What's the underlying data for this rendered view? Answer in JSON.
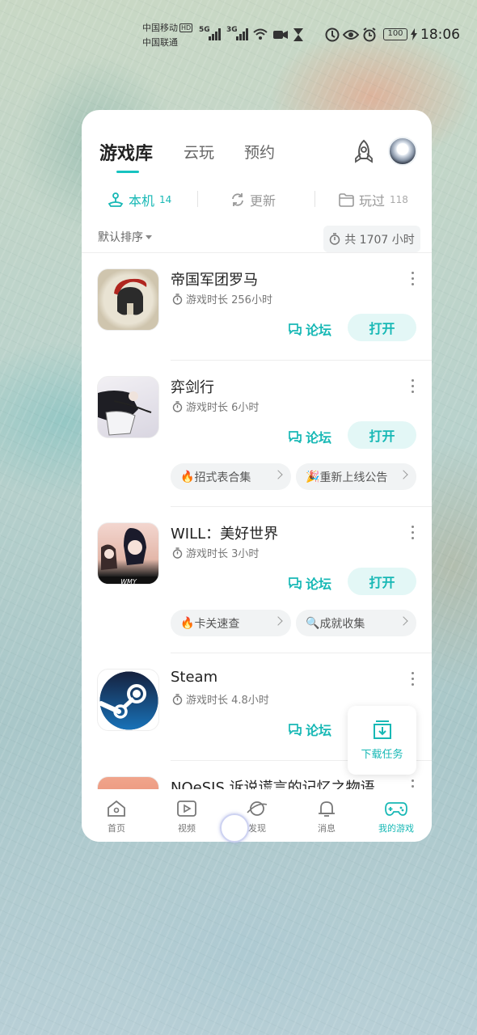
{
  "status_bar": {
    "carrier1": "中国移动",
    "carrier1_badge": "HD",
    "carrier2": "中国联通",
    "net1": "5G",
    "net2": "3G",
    "battery": "100",
    "time": "18:06"
  },
  "header": {
    "tabs": [
      {
        "label": "游戏库",
        "active": true
      },
      {
        "label": "云玩",
        "active": false
      },
      {
        "label": "预约",
        "active": false
      }
    ],
    "icons": [
      "rocket-icon",
      "avatar"
    ]
  },
  "subtabs": [
    {
      "label": "本机",
      "count": "14",
      "active": true
    },
    {
      "label": "更新",
      "count": "",
      "active": false
    },
    {
      "label": "玩过",
      "count": "118",
      "active": false
    }
  ],
  "sort": {
    "label": "默认排序",
    "total": "共 1707 小时"
  },
  "games": [
    {
      "name": "帝国军团罗马",
      "time": "游戏时长 256小时",
      "forum": "论坛",
      "open": "打开",
      "chips": []
    },
    {
      "name": "弈剑行",
      "time": "游戏时长 6小时",
      "forum": "论坛",
      "open": "打开",
      "chips": [
        {
          "emoji": "🔥",
          "label": "招式表合集"
        },
        {
          "emoji": "🎉",
          "label": "重新上线公告"
        }
      ]
    },
    {
      "name": "WILL：美好世界",
      "time": "游戏时长 3小时",
      "forum": "论坛",
      "open": "打开",
      "chips": [
        {
          "emoji": "🔥",
          "label": "卡关速查"
        },
        {
          "emoji": "🔍",
          "label": "成就收集"
        }
      ]
    },
    {
      "name": "Steam",
      "time": "游戏时长 4.8小时",
      "forum": "论坛",
      "open": "",
      "chips": []
    },
    {
      "name": "NOeSIS 诉说谎言的记忆之物语",
      "time": "",
      "forum": "",
      "open": "",
      "chips": []
    }
  ],
  "download_task": {
    "label": "下载任务"
  },
  "bottom_nav": [
    {
      "label": "首页",
      "icon": "home-icon",
      "active": false
    },
    {
      "label": "视频",
      "icon": "video-icon",
      "active": false
    },
    {
      "label": "发现",
      "icon": "planet-icon",
      "active": false
    },
    {
      "label": "消息",
      "icon": "bell-icon",
      "active": false
    },
    {
      "label": "我的游戏",
      "icon": "gamepad-icon",
      "active": true
    }
  ],
  "colors": {
    "accent": "#17b8b5",
    "accent_light": "#e3f7f6"
  }
}
